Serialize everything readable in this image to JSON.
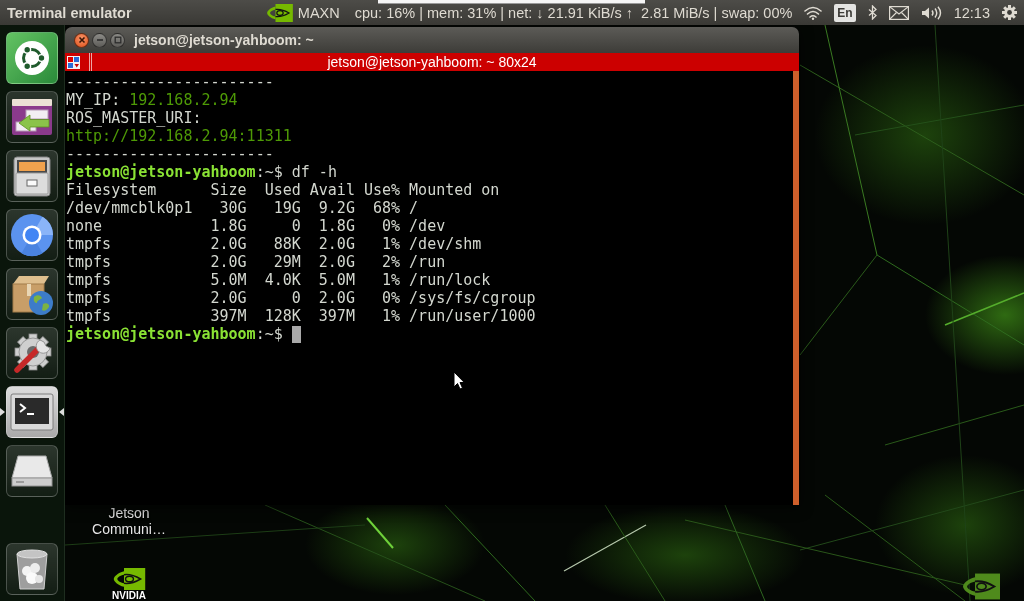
{
  "top_panel": {
    "app_title": "Terminal emulator",
    "power_mode": "MAXN",
    "system_monitor": "cpu: 16% | mem: 31% | net: ↓ 21.91 KiB/s ↑  2.81 MiB/s | swap: 00%",
    "keyboard_layout": "En",
    "clock": "12:13"
  },
  "launcher": {
    "items": [
      {
        "kind": "dash",
        "selected": false
      },
      {
        "kind": "window",
        "selected": false
      },
      {
        "kind": "files",
        "selected": false
      },
      {
        "kind": "browser",
        "selected": false
      },
      {
        "kind": "package",
        "selected": false
      },
      {
        "kind": "settings",
        "selected": false
      },
      {
        "kind": "terminal",
        "selected": true
      },
      {
        "kind": "drive",
        "selected": false
      },
      {
        "kind": "trash",
        "selected": false
      }
    ]
  },
  "terminal": {
    "window_title": "jetson@jetson-yahboom: ~",
    "header_title": "jetson@jetson-yahboom: ~ 80x24",
    "lines": [
      {
        "kind": "text",
        "text": "-----------------------"
      },
      {
        "kind": "field",
        "label": "MY_IP:",
        "value": "192.168.2.94"
      },
      {
        "kind": "text",
        "text": "ROS_MASTER_URI:"
      },
      {
        "kind": "url",
        "text": "http://192.168.2.94:11311"
      },
      {
        "kind": "text",
        "text": "-----------------------"
      },
      {
        "kind": "prompt",
        "user": "jetson@jetson-yahboom",
        "symbol": ":~$",
        "command": "df -h",
        "cursor": false
      },
      {
        "kind": "table",
        "columns": [
          "Filesystem",
          "Size",
          "Used",
          "Avail",
          "Use%",
          "Mounted on"
        ],
        "rows": [
          [
            "/dev/mmcblk0p1",
            "30G",
            "19G",
            "9.2G",
            "68%",
            "/"
          ],
          [
            "none",
            "1.8G",
            "0",
            "1.8G",
            "0%",
            "/dev"
          ],
          [
            "tmpfs",
            "2.0G",
            "88K",
            "2.0G",
            "1%",
            "/dev/shm"
          ],
          [
            "tmpfs",
            "2.0G",
            "29M",
            "2.0G",
            "2%",
            "/run"
          ],
          [
            "tmpfs",
            "5.0M",
            "4.0K",
            "5.0M",
            "1%",
            "/run/lock"
          ],
          [
            "tmpfs",
            "2.0G",
            "0",
            "2.0G",
            "0%",
            "/sys/fs/cgroup"
          ],
          [
            "tmpfs",
            "397M",
            "128K",
            "397M",
            "1%",
            "/run/user/1000"
          ]
        ]
      },
      {
        "kind": "prompt",
        "user": "jetson@jetson-yahboom",
        "symbol": ":~$",
        "cursor": true
      }
    ]
  },
  "desktop": {
    "icons": [
      {
        "kind": "label",
        "label": "Jetson Communi…"
      },
      {
        "kind": "logo",
        "label": "NVIDIA"
      }
    ]
  }
}
